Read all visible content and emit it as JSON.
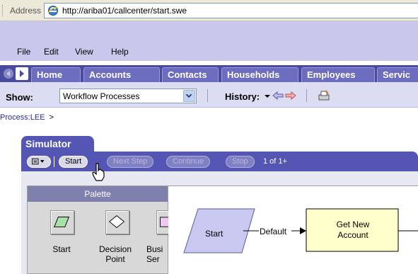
{
  "address_bar": {
    "label": "Address",
    "url": "http://ariba01/callcenter/start.swe"
  },
  "menu": {
    "items": [
      "File",
      "Edit",
      "View",
      "Help"
    ]
  },
  "tabs": [
    "Home",
    "Accounts",
    "Contacts",
    "Households",
    "Employees",
    "Servic"
  ],
  "toolbar": {
    "show_label": "Show:",
    "show_value": "Workflow Processes",
    "history_label": "History:"
  },
  "breadcrumb": {
    "text": "Process:LEE",
    "separator": ">"
  },
  "simulator": {
    "title": "Simulator",
    "buttons": [
      {
        "label": "Start",
        "enabled": true
      },
      {
        "label": "Next Step",
        "enabled": false
      },
      {
        "label": "Continue",
        "enabled": false
      },
      {
        "label": "Stop",
        "enabled": false
      }
    ],
    "count": "1 of 1+"
  },
  "palette": {
    "title": "Palette",
    "items": [
      {
        "label": "Start",
        "icon": "start-parallelogram-icon"
      },
      {
        "label": "Decision Point",
        "icon": "decision-diamond-icon"
      },
      {
        "label": "Busi Ser",
        "icon": "business-service-icon"
      }
    ]
  },
  "canvas": {
    "nodes": [
      {
        "label": "Start",
        "shape": "parallelogram"
      },
      {
        "label": "Get New Account",
        "shape": "rectangle"
      }
    ],
    "connector_label": "Default"
  },
  "colors": {
    "menu_bg": "#c8c8ec",
    "tab_strip": "#4a4a9e",
    "tab": "#6d6dc0",
    "simulator": "#5555b4",
    "start_node": "#c8c8f0",
    "task_node": "#ffffcc"
  }
}
